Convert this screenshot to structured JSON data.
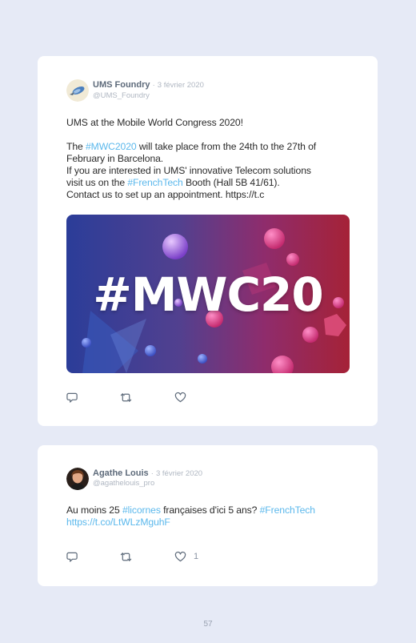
{
  "tweets": [
    {
      "author": "UMS Foundry",
      "separator": "·",
      "date": "3 février 2020",
      "handle": "@UMS_Foundry",
      "lines": {
        "l1": "UMS at the Mobile World Congress 2020!",
        "l2a": "The ",
        "l2h": "#MWC2020",
        "l2b": " will take place from the 24th to the 27th of February in Barcelona.",
        "l3": "If you are interested in UMS' innovative Telecom solutions",
        "l4a": "visit us on the ",
        "l4h": "#FrenchTech",
        "l4b": " Booth (Hall 5B 41/61).",
        "l5": "Contact us to set up an appointment. https://t.c"
      },
      "media_text": "#MWC20",
      "actions": {
        "reply_icon": "reply-icon",
        "retweet_icon": "retweet-icon",
        "like_icon": "heart-icon"
      }
    },
    {
      "author": "Agathe Louis",
      "separator": "·",
      "date": "3 février 2020",
      "handle": "@agathelouis_pro",
      "lines": {
        "a": "Au moins 25 ",
        "h1": "#licornes",
        "b": " françaises d'ici 5 ans? ",
        "h2": "#FrenchTech",
        "link": "https://t.co/LtWLzMguhF"
      },
      "like_count": "1",
      "actions": {
        "reply_icon": "reply-icon",
        "retweet_icon": "retweet-icon",
        "like_icon": "heart-icon"
      }
    }
  ],
  "page_number": "57",
  "colors": {
    "hashtag": "#5bb8ec",
    "background": "#e6eaf6",
    "card": "#ffffff"
  }
}
